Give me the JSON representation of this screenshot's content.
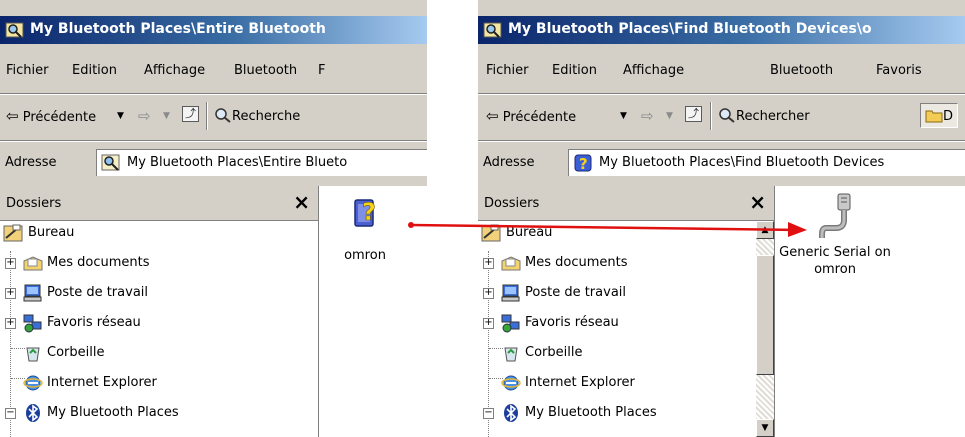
{
  "left_window": {
    "title": "My Bluetooth Places\\Entire Bluetooth",
    "menu": [
      "Fichier",
      "Edition",
      "Affichage",
      "Bluetooth",
      "F"
    ],
    "toolbar": {
      "back_label": "Précédente",
      "search_label": "Recherche"
    },
    "address": {
      "label": "Adresse",
      "value": "My Bluetooth Places\\Entire Blueto"
    },
    "folders": {
      "title": "Dossiers",
      "close": "×",
      "items": [
        "Bureau",
        "Mes documents",
        "Poste de travail",
        "Favoris réseau",
        "Corbeille",
        "Internet Explorer",
        "My Bluetooth Places"
      ]
    },
    "content": {
      "items": [
        {
          "label": "omron",
          "icon": "unknown-bluetooth-device-icon"
        }
      ]
    }
  },
  "right_window": {
    "title": "My Bluetooth Places\\Find Bluetooth Devices\\o",
    "menu": [
      "Fichier",
      "Edition",
      "Affichage",
      "Bluetooth",
      "Favoris"
    ],
    "toolbar": {
      "back_label": "Précédente",
      "search_label": "Rechercher",
      "folders_label": "D"
    },
    "address": {
      "label": "Adresse",
      "value": "My Bluetooth Places\\Find Bluetooth Devices"
    },
    "folders": {
      "title": "Dossiers",
      "close": "×",
      "items": [
        "Bureau",
        "Mes documents",
        "Poste de travail",
        "Favoris réseau",
        "Corbeille",
        "Internet Explorer",
        "My Bluetooth Places"
      ]
    },
    "content": {
      "items": [
        {
          "label_line1": "Generic Serial on",
          "label_line2": "omron",
          "icon": "serial-port-icon"
        }
      ]
    }
  },
  "colors": {
    "titlebar_start": "#0a246a",
    "titlebar_end": "#a6caf0",
    "annotation_arrow": "#e01010",
    "chrome": "#d4d0c8"
  }
}
